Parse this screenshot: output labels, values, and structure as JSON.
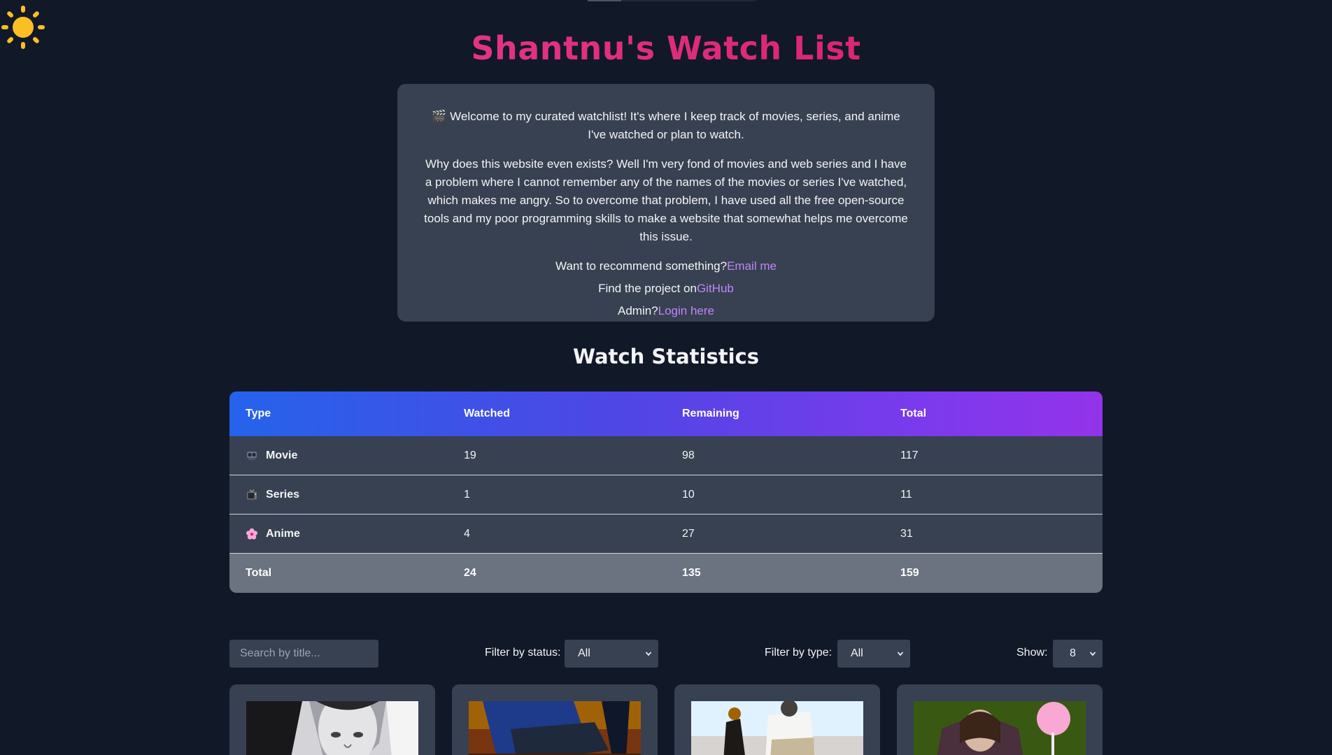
{
  "page": {
    "title": "Shantnu's Watch List"
  },
  "intro": {
    "welcome_icon": "clapper-board-icon",
    "welcome": "🎬 Welcome to my curated watchlist! It's where I keep track of movies, series, and anime I've watched or plan to watch.",
    "why": "Why does this website even exists? Well I'm very fond of movies and web series and I have a problem where I cannot remember any of the names of the movies or series I've watched, which makes me angry. So to overcome that problem, I have used all the free open-source tools and my poor programming skills to make a website that somewhat helps me overcome this issue.",
    "recommend_text": "Want to recommend something?",
    "recommend_link": "Email me",
    "github_text": "Find the project on",
    "github_link": "GitHub",
    "admin_text": "Admin?",
    "admin_link": "Login here"
  },
  "theme_toggle": {
    "icon": "sun-icon",
    "color": "#fbbf24"
  },
  "stats": {
    "title": "Watch Statistics",
    "headers": [
      "Type",
      "Watched",
      "Remaining",
      "Total"
    ],
    "rows": [
      {
        "icon": "film-projector-icon",
        "type": "Movie",
        "watched": "19",
        "remaining": "98",
        "total": "117"
      },
      {
        "icon": "television-icon",
        "type": "Series",
        "watched": "1",
        "remaining": "10",
        "total": "11"
      },
      {
        "icon": "cherry-blossom-icon",
        "type": "Anime",
        "watched": "4",
        "remaining": "27",
        "total": "31"
      }
    ],
    "total_row": {
      "type": "Total",
      "watched": "24",
      "remaining": "135",
      "total": "159"
    }
  },
  "controls": {
    "search_placeholder": "Search by title...",
    "status_label": "Filter by status:",
    "status_value": "All",
    "type_label": "Filter by type:",
    "type_value": "All",
    "show_label": "Show:",
    "show_value": "8"
  },
  "colors": {
    "background": "#111827",
    "panel": "#374151",
    "title_pink": "#ec4899",
    "link_purple": "#c084fc",
    "header_gradient_start": "#2563eb",
    "header_gradient_end": "#9333ea"
  }
}
